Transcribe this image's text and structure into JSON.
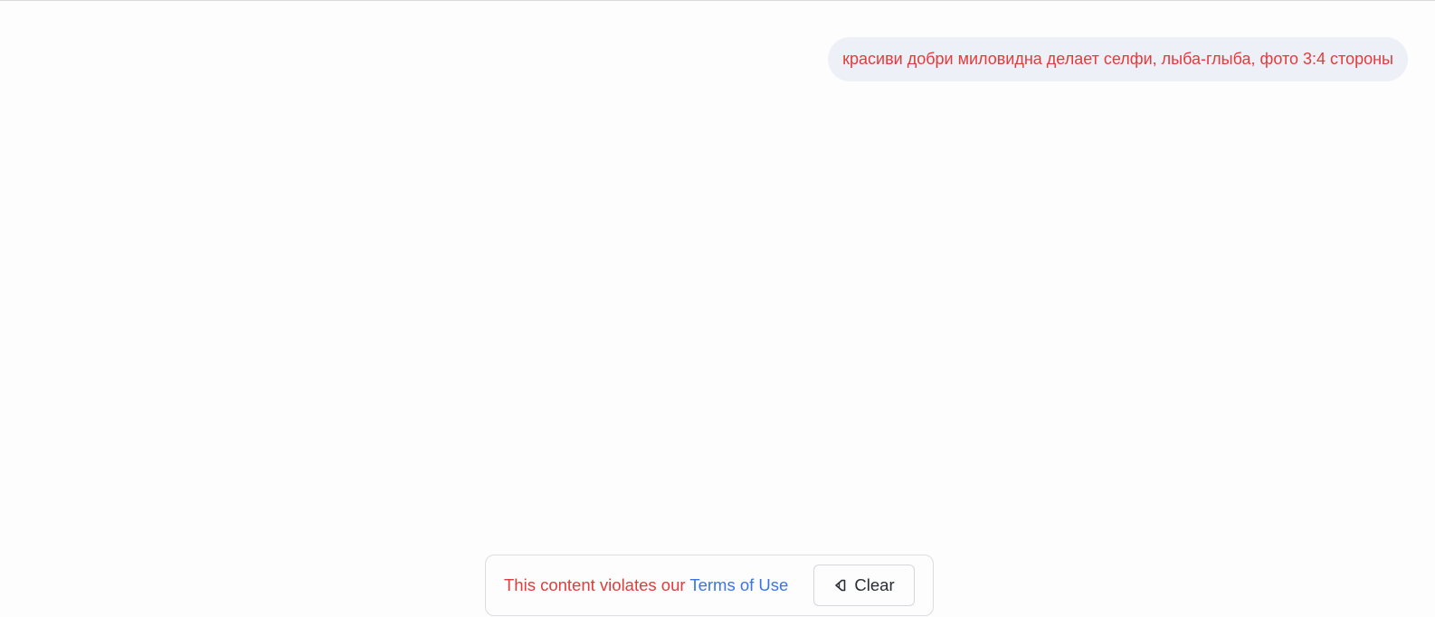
{
  "chat": {
    "messages": [
      {
        "role": "user",
        "text": "красиви добри миловидна делает селфи, лыба-глыба, фото 3:4 стороны"
      }
    ]
  },
  "footer": {
    "notice_prefix": "This content violates our ",
    "notice_link": "Terms of Use",
    "clear_label": "Clear",
    "clear_icon": "eraser-icon"
  },
  "colors": {
    "error_text": "#e23b3b",
    "link": "#3b73e8",
    "bubble_bg": "#eef0f8",
    "page_bg": "#fdfdfd"
  }
}
